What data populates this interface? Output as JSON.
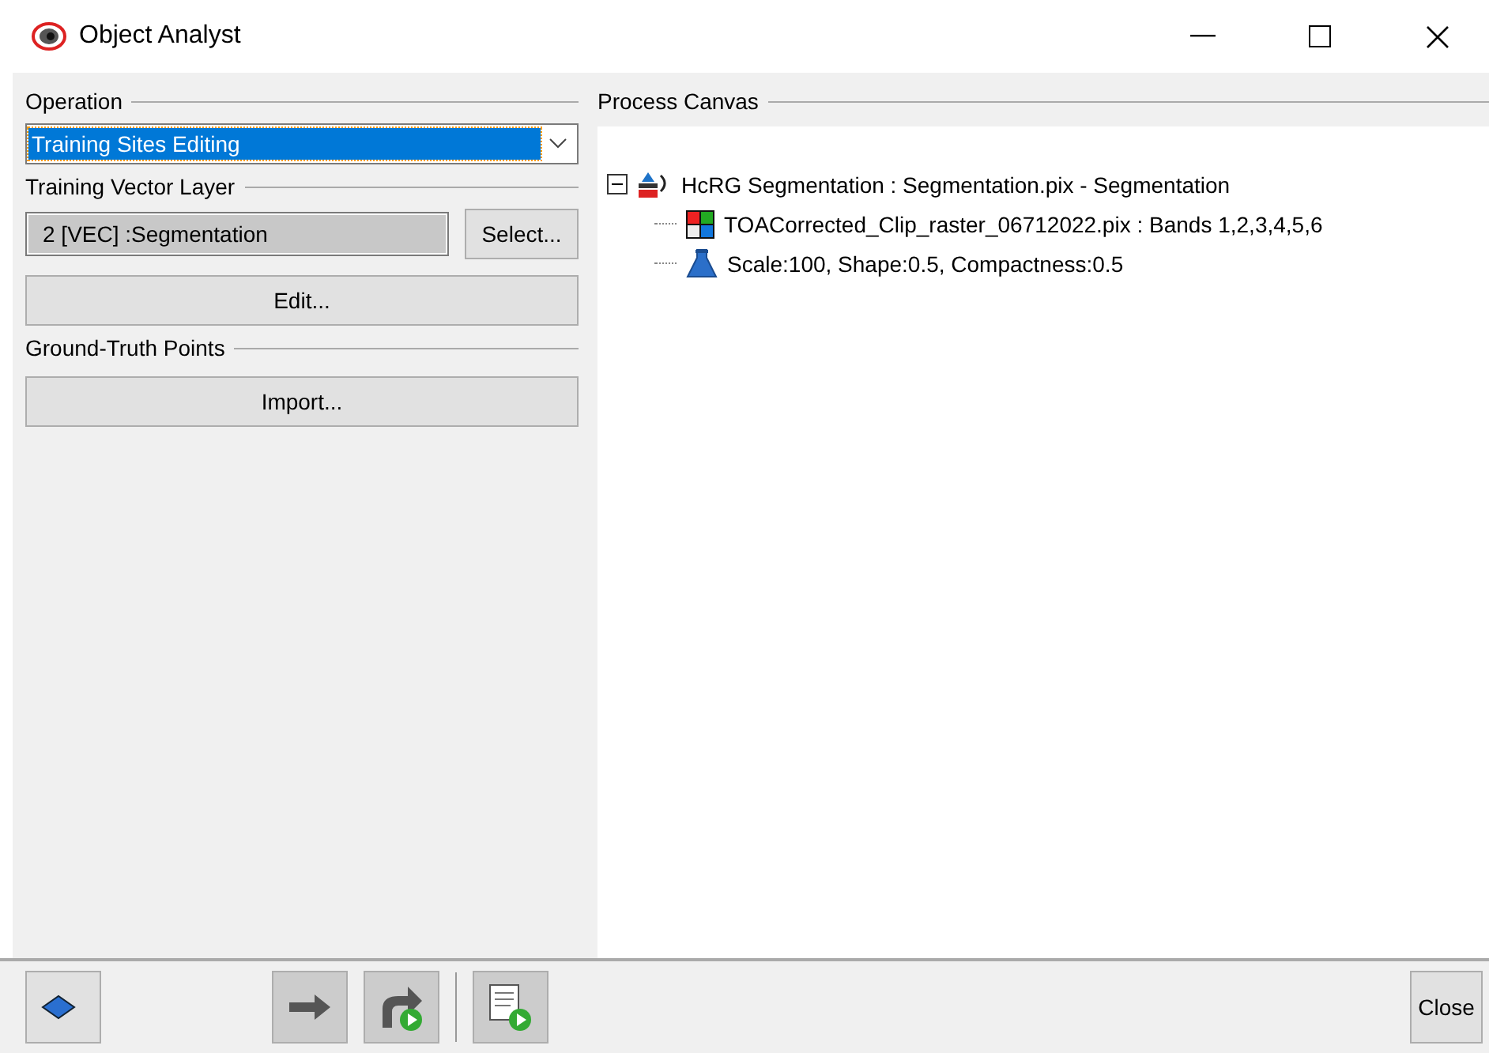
{
  "window": {
    "title": "Object Analyst"
  },
  "operation": {
    "heading": "Operation",
    "value": "Training Sites Editing"
  },
  "training_vector_layer": {
    "heading": "Training Vector Layer",
    "value": "2 [VEC] :Segmentation",
    "select_button": "Select...",
    "edit_button": "Edit..."
  },
  "ground_truth_points": {
    "heading": "Ground-Truth Points",
    "import_button": "Import..."
  },
  "process_canvas": {
    "heading": "Process Canvas",
    "tree": [
      {
        "label": "HcRG Segmentation : Segmentation.pix - Segmentation",
        "kind": "segmentation",
        "expanded": true,
        "children": [
          {
            "label": "TOACorrected_Clip_raster_06712022.pix : Bands 1,2,3,4,5,6",
            "kind": "raster"
          },
          {
            "label": "Scale:100, Shape:0.5, Compactness:0.5",
            "kind": "parameters"
          }
        ]
      }
    ]
  },
  "footer": {
    "close_button": "Close"
  }
}
